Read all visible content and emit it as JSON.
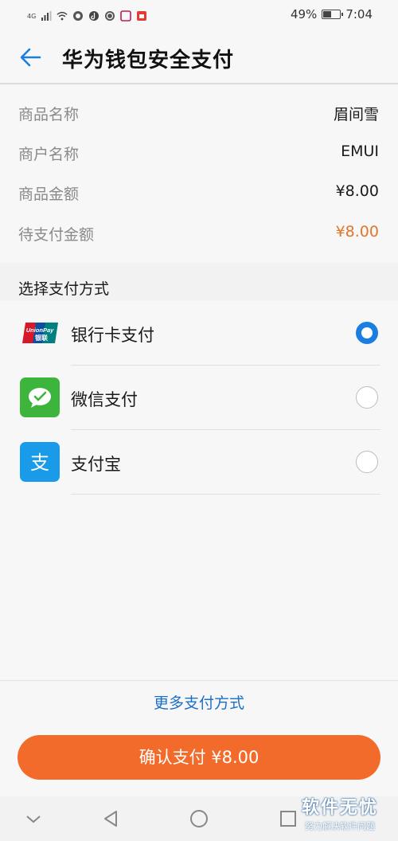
{
  "status_bar": {
    "network": "4G",
    "battery": "49%",
    "battery_level": 0.49,
    "time": "7:04"
  },
  "header": {
    "title": "华为钱包安全支付"
  },
  "order_info": [
    {
      "label": "商品名称",
      "value": "眉间雪",
      "highlight": false
    },
    {
      "label": "商户名称",
      "value": "EMUI",
      "highlight": false
    },
    {
      "label": "商品金额",
      "value": "¥8.00",
      "highlight": false
    },
    {
      "label": "待支付金额",
      "value": "¥8.00",
      "highlight": true
    }
  ],
  "payment": {
    "section_title": "选择支付方式",
    "methods": [
      {
        "label": "银行卡支付",
        "icon": "unionpay-icon",
        "selected": true
      },
      {
        "label": "微信支付",
        "icon": "wechat-pay-icon",
        "selected": false
      },
      {
        "label": "支付宝",
        "icon": "alipay-icon",
        "selected": false
      }
    ],
    "more_label": "更多支付方式",
    "confirm_label": "确认支付 ¥8.00"
  },
  "watermark": {
    "title": "软件无忧",
    "subtitle": "努力解决软件问题"
  },
  "colors": {
    "accent_blue": "#1a7fe0",
    "confirm_orange": "#f26b2b",
    "amount_orange": "#e0762a"
  }
}
